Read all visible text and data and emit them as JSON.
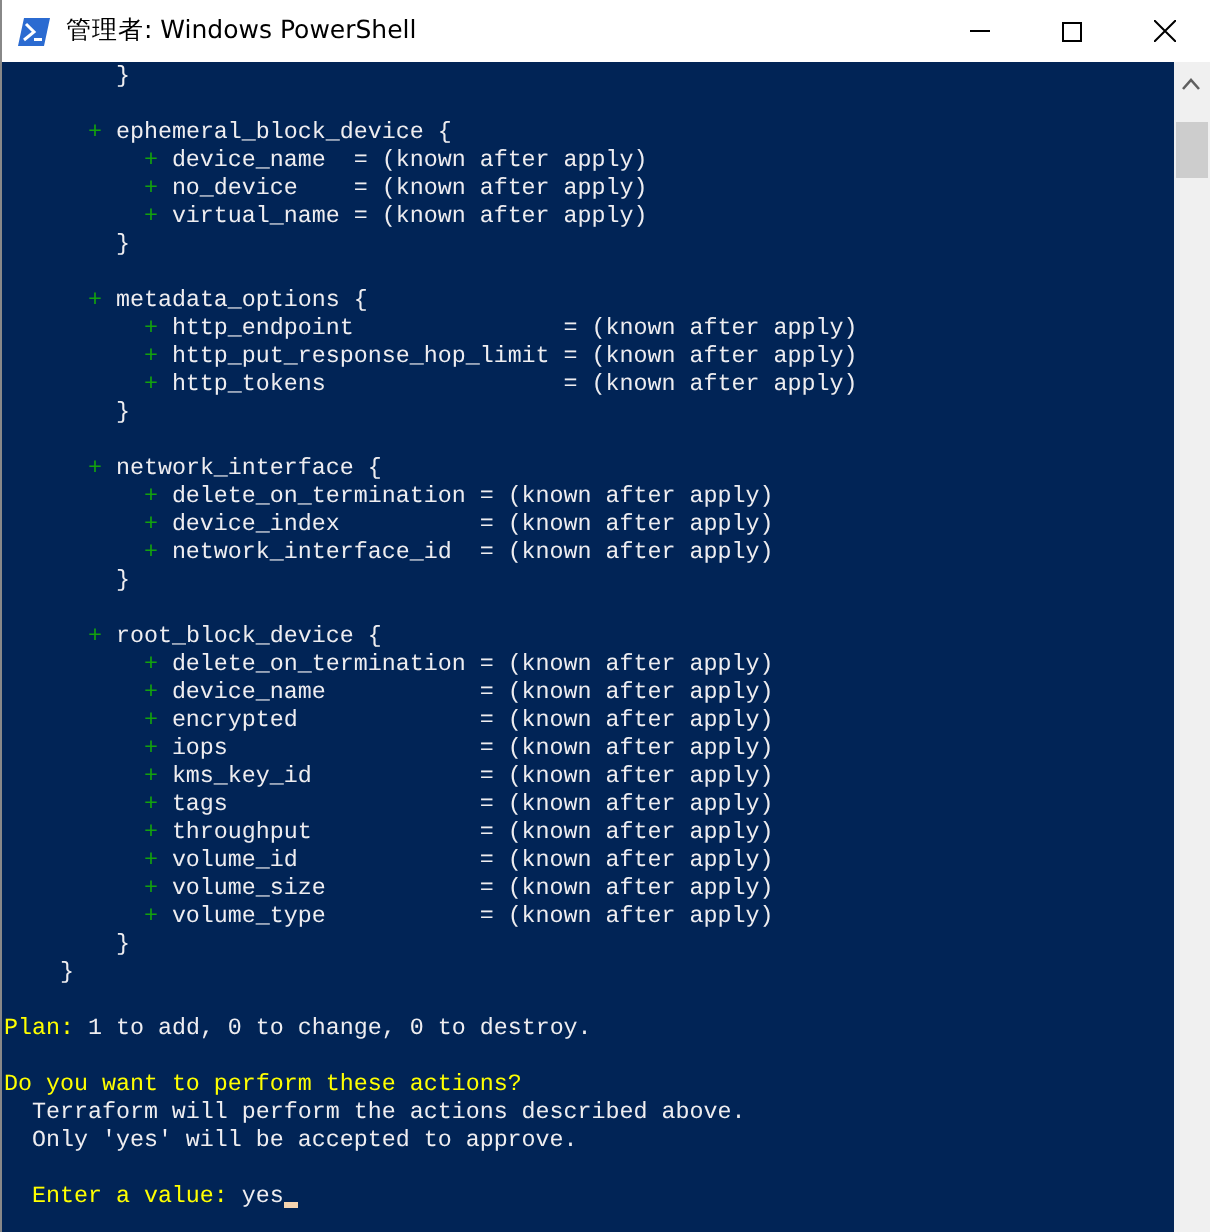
{
  "window": {
    "title": "管理者: Windows PowerShell"
  },
  "diff": {
    "items": [
      {
        "kind": "close",
        "text": "}"
      },
      {
        "kind": "block",
        "marker": "+",
        "text": "ephemeral_block_device {",
        "close": "}",
        "children": [
          {
            "kind": "attr",
            "marker": "+",
            "text": "device_name  = (known after apply)"
          },
          {
            "kind": "attr",
            "marker": "+",
            "text": "no_device    = (known after apply)"
          },
          {
            "kind": "attr",
            "marker": "+",
            "text": "virtual_name = (known after apply)"
          }
        ]
      },
      {
        "kind": "block",
        "marker": "+",
        "text": "metadata_options {",
        "close": "}",
        "children": [
          {
            "kind": "attr",
            "marker": "+",
            "text": "http_endpoint               = (known after apply)"
          },
          {
            "kind": "attr",
            "marker": "+",
            "text": "http_put_response_hop_limit = (known after apply)"
          },
          {
            "kind": "attr",
            "marker": "+",
            "text": "http_tokens                 = (known after apply)"
          }
        ]
      },
      {
        "kind": "block",
        "marker": "+",
        "text": "network_interface {",
        "close": "}",
        "children": [
          {
            "kind": "attr",
            "marker": "+",
            "text": "delete_on_termination = (known after apply)"
          },
          {
            "kind": "attr",
            "marker": "+",
            "text": "device_index          = (known after apply)"
          },
          {
            "kind": "attr",
            "marker": "+",
            "text": "network_interface_id  = (known after apply)"
          }
        ]
      },
      {
        "kind": "block",
        "marker": "+",
        "text": "root_block_device {",
        "close": "}",
        "children": [
          {
            "kind": "attr",
            "marker": "+",
            "text": "delete_on_termination = (known after apply)"
          },
          {
            "kind": "attr",
            "marker": "+",
            "text": "device_name           = (known after apply)"
          },
          {
            "kind": "attr",
            "marker": "+",
            "text": "encrypted             = (known after apply)"
          },
          {
            "kind": "attr",
            "marker": "+",
            "text": "iops                  = (known after apply)"
          },
          {
            "kind": "attr",
            "marker": "+",
            "text": "kms_key_id            = (known after apply)"
          },
          {
            "kind": "attr",
            "marker": "+",
            "text": "tags                  = (known after apply)"
          },
          {
            "kind": "attr",
            "marker": "+",
            "text": "throughput            = (known after apply)"
          },
          {
            "kind": "attr",
            "marker": "+",
            "text": "volume_id             = (known after apply)"
          },
          {
            "kind": "attr",
            "marker": "+",
            "text": "volume_size           = (known after apply)"
          },
          {
            "kind": "attr",
            "marker": "+",
            "text": "volume_type           = (known after apply)"
          }
        ]
      }
    ],
    "close": "}"
  },
  "summary": {
    "label": "Plan:",
    "text": "1 to add, 0 to change, 0 to destroy."
  },
  "prompt": {
    "question": "Do you want to perform these actions?",
    "details": [
      "Terraform will perform the actions described above.",
      "Only 'yes' will be accepted to approve."
    ],
    "label": "Enter a value:",
    "value": "yes"
  }
}
